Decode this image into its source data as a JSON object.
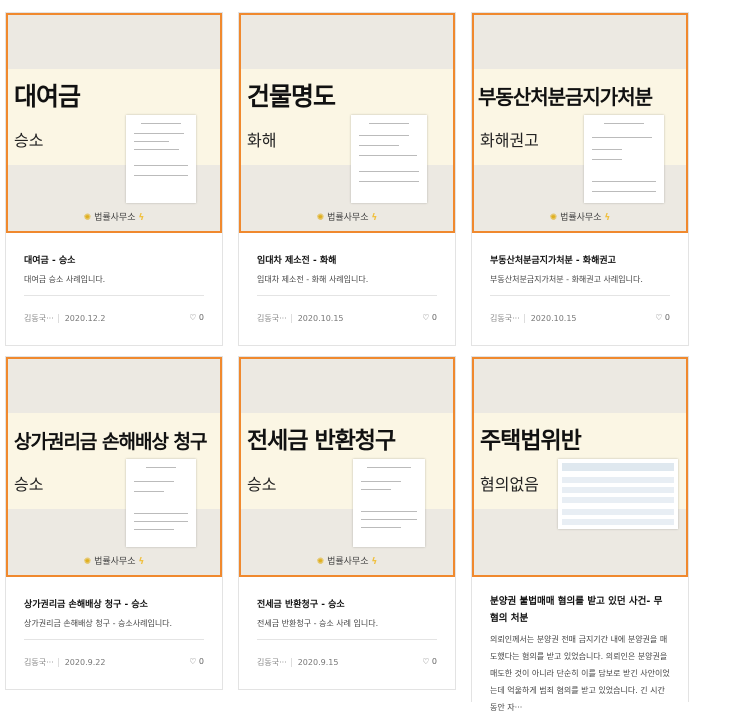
{
  "cards": [
    {
      "big": "대여금",
      "sub": "승소",
      "title": "대여금 - 승소",
      "desc": "대여금 승소 사례입니다.",
      "author": "김동국···",
      "date": "2020.12.2",
      "comments": "0"
    },
    {
      "big": "건물명도",
      "sub": "화해",
      "title": "임대차 제소전 - 화해",
      "desc": "임대차 제소전 - 화해 사례입니다.",
      "author": "김동국···",
      "date": "2020.10.15",
      "comments": "0"
    },
    {
      "big": "부동산처분금지가처분",
      "sub": "화해권고",
      "title": "부동산처분금지가처분 - 화해권고",
      "desc": "부동산처분금지가처분 - 화해권고 사례입니다.",
      "author": "김동국···",
      "date": "2020.10.15",
      "comments": "0"
    },
    {
      "big": "상가권리금 손해배상 청구",
      "sub": "승소",
      "title": "상가권리금 손해배상 청구 - 승소",
      "desc": "상가권리금 손해배상 청구 - 승소사례입니다.",
      "author": "김동국···",
      "date": "2020.9.22",
      "comments": "0"
    },
    {
      "big": "전세금 반환청구",
      "sub": "승소",
      "title": "전세금 반환청구 - 승소",
      "desc": "전세금 반환청구 - 승소 사례 입니다.",
      "author": "김동국···",
      "date": "2020.9.15",
      "comments": "0"
    },
    {
      "big": "주택법위반",
      "sub": "혐의없음",
      "title": "분양권 불법매매 혐의를 받고 있던 사건- 무혐의 처분",
      "desc": "의뢰인께서는 분양권 전매 금지기간 내에 분양권을 매도했다는 혐의를 받고 있었습니다. 의뢰인은 분양권을 매도한 것이 아니라 단순히 이를 담보로 받긴 사안이었는데 억울하게 범죄 혐의를 받고 있었습니다.  긴 시간 동안 자···"
    }
  ],
  "logo_text": "법률사무소"
}
